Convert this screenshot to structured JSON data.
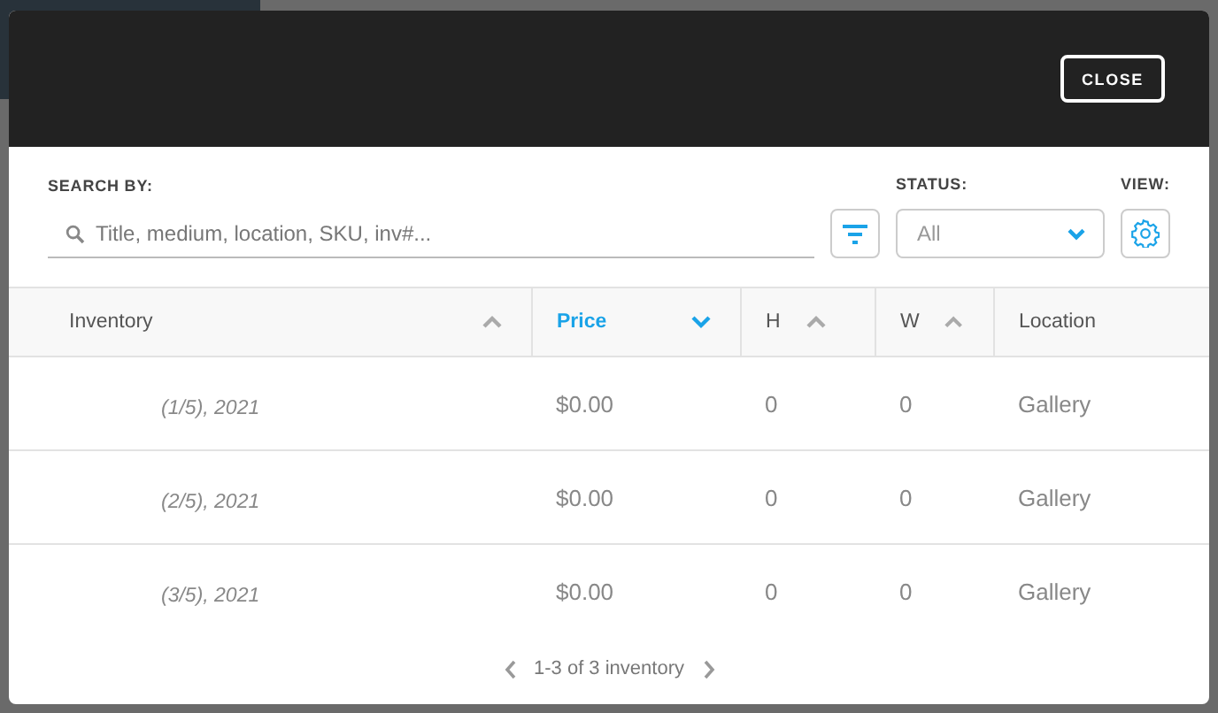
{
  "header": {
    "close_button": "CLOSE"
  },
  "filters": {
    "search_label": "SEARCH BY:",
    "search": {
      "placeholder": "Title, medium, location, SKU, inv#..."
    },
    "status_label": "STATUS:",
    "status": {
      "value": "All"
    },
    "view_label": "VIEW:"
  },
  "table": {
    "columns": [
      {
        "label": "Inventory",
        "selected": false,
        "sortable": true,
        "descending": false
      },
      {
        "label": "Price",
        "selected": true,
        "sortable": true,
        "descending": true
      },
      {
        "label": "H",
        "selected": false,
        "sortable": true,
        "descending": false
      },
      {
        "label": "W",
        "selected": false,
        "sortable": true,
        "descending": false
      },
      {
        "label": "Location",
        "selected": false,
        "sortable": false
      }
    ],
    "rows": [
      [
        "(1/5), 2021",
        "$0.00",
        "0",
        "0",
        "Gallery"
      ],
      [
        "(2/5), 2021",
        "$0.00",
        "0",
        "0",
        "Gallery"
      ],
      [
        "(3/5), 2021",
        "$0.00",
        "0",
        "0",
        "Gallery"
      ]
    ]
  },
  "pagination": {
    "text": "1-3 of 3 inventory"
  }
}
